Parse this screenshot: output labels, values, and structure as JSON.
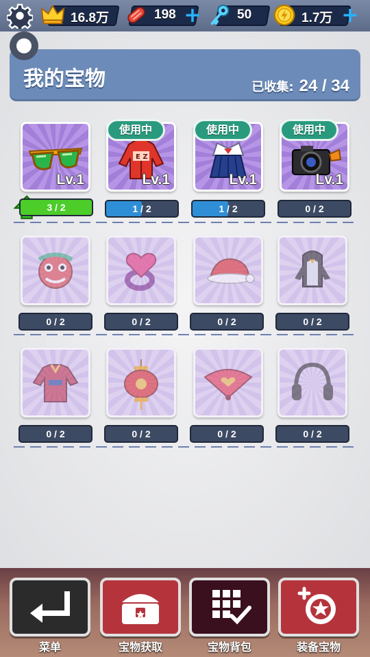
{
  "topbar": {
    "crowns": "16.8万",
    "tickets": "198",
    "keys": "50",
    "coins": "1.7万"
  },
  "header": {
    "title": "我的宝物",
    "collected_label": "已收集:",
    "collected_value": "24 / 34"
  },
  "in_use_label": "使用中",
  "items": [
    {
      "name": "sunglasses",
      "level": "Lv.1",
      "progress": "3 / 2",
      "progress_fraction": 1.0,
      "in_use": false,
      "unlocked": true,
      "bar_color": "#4ccd2a"
    },
    {
      "name": "red-jacket",
      "level": "Lv.1",
      "progress": "1 / 2",
      "progress_fraction": 0.5,
      "in_use": true,
      "unlocked": true,
      "bar_color": "#2f8fd6"
    },
    {
      "name": "school-uniform",
      "level": "Lv.1",
      "progress": "1 / 2",
      "progress_fraction": 0.5,
      "in_use": true,
      "unlocked": true,
      "bar_color": "#2f8fd6"
    },
    {
      "name": "camera",
      "level": "Lv.1",
      "progress": "0 / 2",
      "progress_fraction": 0,
      "in_use": true,
      "unlocked": true,
      "bar_color": "#2f8fd6"
    },
    {
      "name": "lion-dance-head",
      "progress": "0 / 2",
      "unlocked": false
    },
    {
      "name": "heart-ring",
      "progress": "0 / 2",
      "unlocked": false
    },
    {
      "name": "santa-hat",
      "progress": "0 / 2",
      "unlocked": false
    },
    {
      "name": "penguin-costume",
      "progress": "0 / 2",
      "unlocked": false
    },
    {
      "name": "chinese-robe",
      "progress": "0 / 2",
      "unlocked": false
    },
    {
      "name": "red-lantern",
      "progress": "0 / 2",
      "unlocked": false
    },
    {
      "name": "heart-fan",
      "progress": "0 / 2",
      "unlocked": false
    },
    {
      "name": "headphones",
      "progress": "0 / 2",
      "unlocked": false
    }
  ],
  "nav": [
    {
      "label": "菜单",
      "color": "#2b2b2b"
    },
    {
      "label": "宝物获取",
      "color": "#b5343c"
    },
    {
      "label": "宝物背包",
      "color": "#3a0f1e"
    },
    {
      "label": "装备宝物",
      "color": "#b5343c"
    }
  ]
}
